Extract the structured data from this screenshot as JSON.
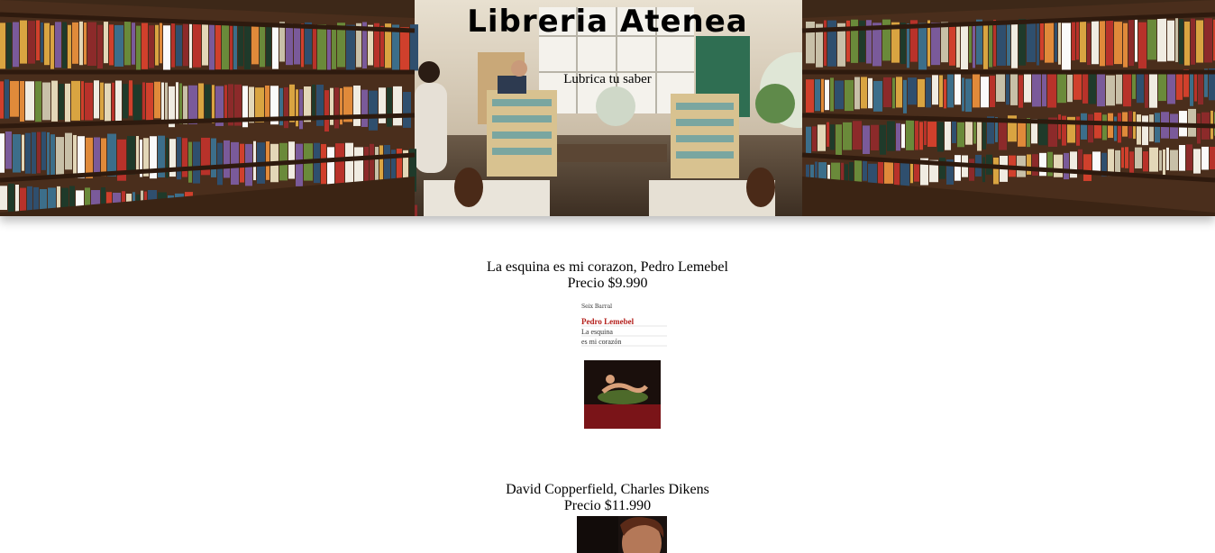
{
  "header": {
    "title": "Libreria Atenea",
    "subtitle": "Lubrica tu saber"
  },
  "products": [
    {
      "name": "La esquina es mi corazon, Pedro Lemebel",
      "price": "Precio $9.990",
      "cover": {
        "publisher_mark": "Seix Barral",
        "author": "Pedro Lemebel",
        "title_line1": "La esquina",
        "title_line2": "es mi corazón"
      }
    },
    {
      "name": "David Copperfield, Charles Dikens",
      "price": "Precio $11.990"
    }
  ],
  "colors": {
    "background": "#ffffff",
    "cover_author_red": "#b4201c",
    "shelf_wood": "#4a2e1c"
  }
}
